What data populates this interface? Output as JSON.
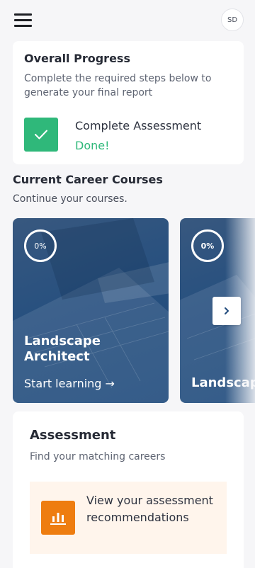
{
  "header": {
    "menu_icon": "hamburger-menu-icon",
    "avatar_initials": "SD"
  },
  "overall_progress": {
    "title": "Overall Progress",
    "description": "Complete the required steps below to generate your final report",
    "step": {
      "icon": "checkmark-icon",
      "label": "Complete Assessment",
      "status": "Done!"
    }
  },
  "courses": {
    "title": "Current Career Courses",
    "subtitle": "Continue your courses.",
    "items": [
      {
        "progress": "0%",
        "name": "Landscape Architect",
        "action": "Start learning →"
      },
      {
        "progress": "0%",
        "name": "Landscap"
      }
    ],
    "next_icon": "chevron-right-icon"
  },
  "assessment": {
    "title": "Assessment",
    "subtitle": "Find your matching careers",
    "recommendation": {
      "icon": "bar-chart-icon",
      "text": "View your assessment recommendations"
    }
  },
  "colors": {
    "success": "#2fb87a",
    "accent_orange": "#ee7d10",
    "card_blue": "#27507f",
    "reco_bg": "#fff5ec"
  }
}
